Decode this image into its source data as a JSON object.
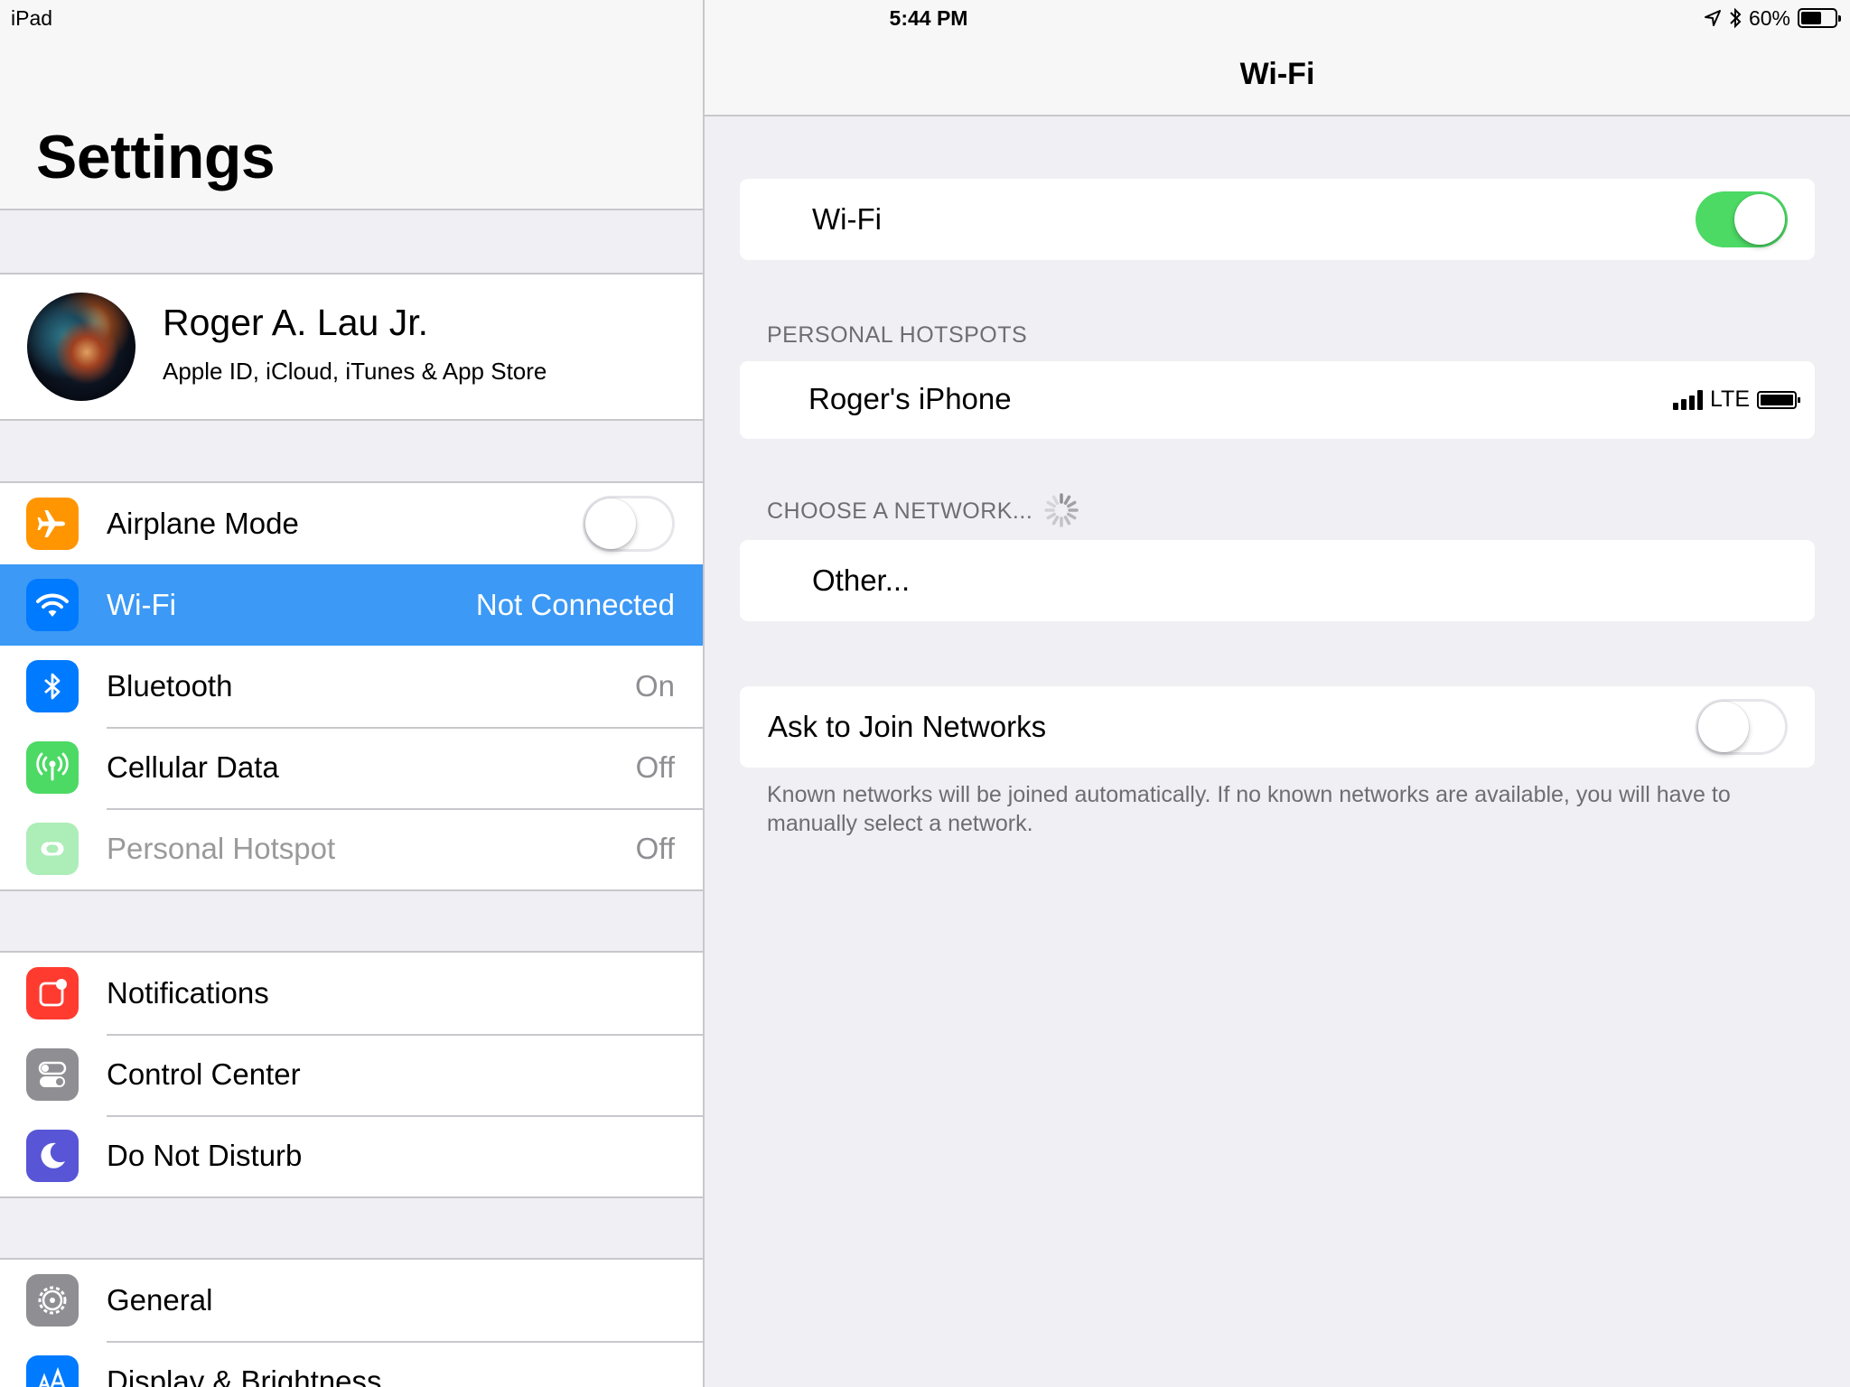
{
  "status_bar": {
    "device": "iPad",
    "time": "5:44 PM",
    "battery": "60%",
    "battery_level": 0.6
  },
  "sidebar": {
    "title": "Settings",
    "profile": {
      "name": "Roger A. Lau Jr.",
      "subtitle": "Apple ID, iCloud, iTunes & App Store"
    },
    "group1": [
      {
        "label": "Airplane Mode",
        "icon": "airplane-icon",
        "color": "#ff9500",
        "toggle": false
      },
      {
        "label": "Wi-Fi",
        "value": "Not Connected",
        "icon": "wifi-icon",
        "color": "#007aff",
        "selected": true
      },
      {
        "label": "Bluetooth",
        "value": "On",
        "icon": "bluetooth-icon",
        "color": "#007aff"
      },
      {
        "label": "Cellular Data",
        "value": "Off",
        "icon": "antenna-icon",
        "color": "#4cd964"
      },
      {
        "label": "Personal Hotspot",
        "value": "Off",
        "icon": "hotspot-icon",
        "color": "#4cd964",
        "disabled": true
      }
    ],
    "group2": [
      {
        "label": "Notifications",
        "icon": "notifications-icon",
        "color": "#ff3b30"
      },
      {
        "label": "Control Center",
        "icon": "control-center-icon",
        "color": "#8e8e93"
      },
      {
        "label": "Do Not Disturb",
        "icon": "moon-icon",
        "color": "#5856d6"
      }
    ],
    "group3": [
      {
        "label": "General",
        "icon": "gear-icon",
        "color": "#8e8e93"
      },
      {
        "label": "Display & Brightness",
        "icon": "text-size-icon",
        "color": "#007aff"
      }
    ]
  },
  "detail": {
    "title": "Wi-Fi",
    "wifi_toggle": {
      "label": "Wi-Fi",
      "on": true
    },
    "personal_hotspots_header": "PERSONAL HOTSPOTS",
    "hotspot": {
      "name": "Roger's iPhone",
      "network": "LTE"
    },
    "choose_network_header": "CHOOSE A NETWORK...",
    "other": "Other...",
    "ask_to_join": {
      "label": "Ask to Join Networks",
      "on": false
    },
    "footer": "Known networks will be joined automatically. If no known networks are available, you will have to manually select a network."
  }
}
